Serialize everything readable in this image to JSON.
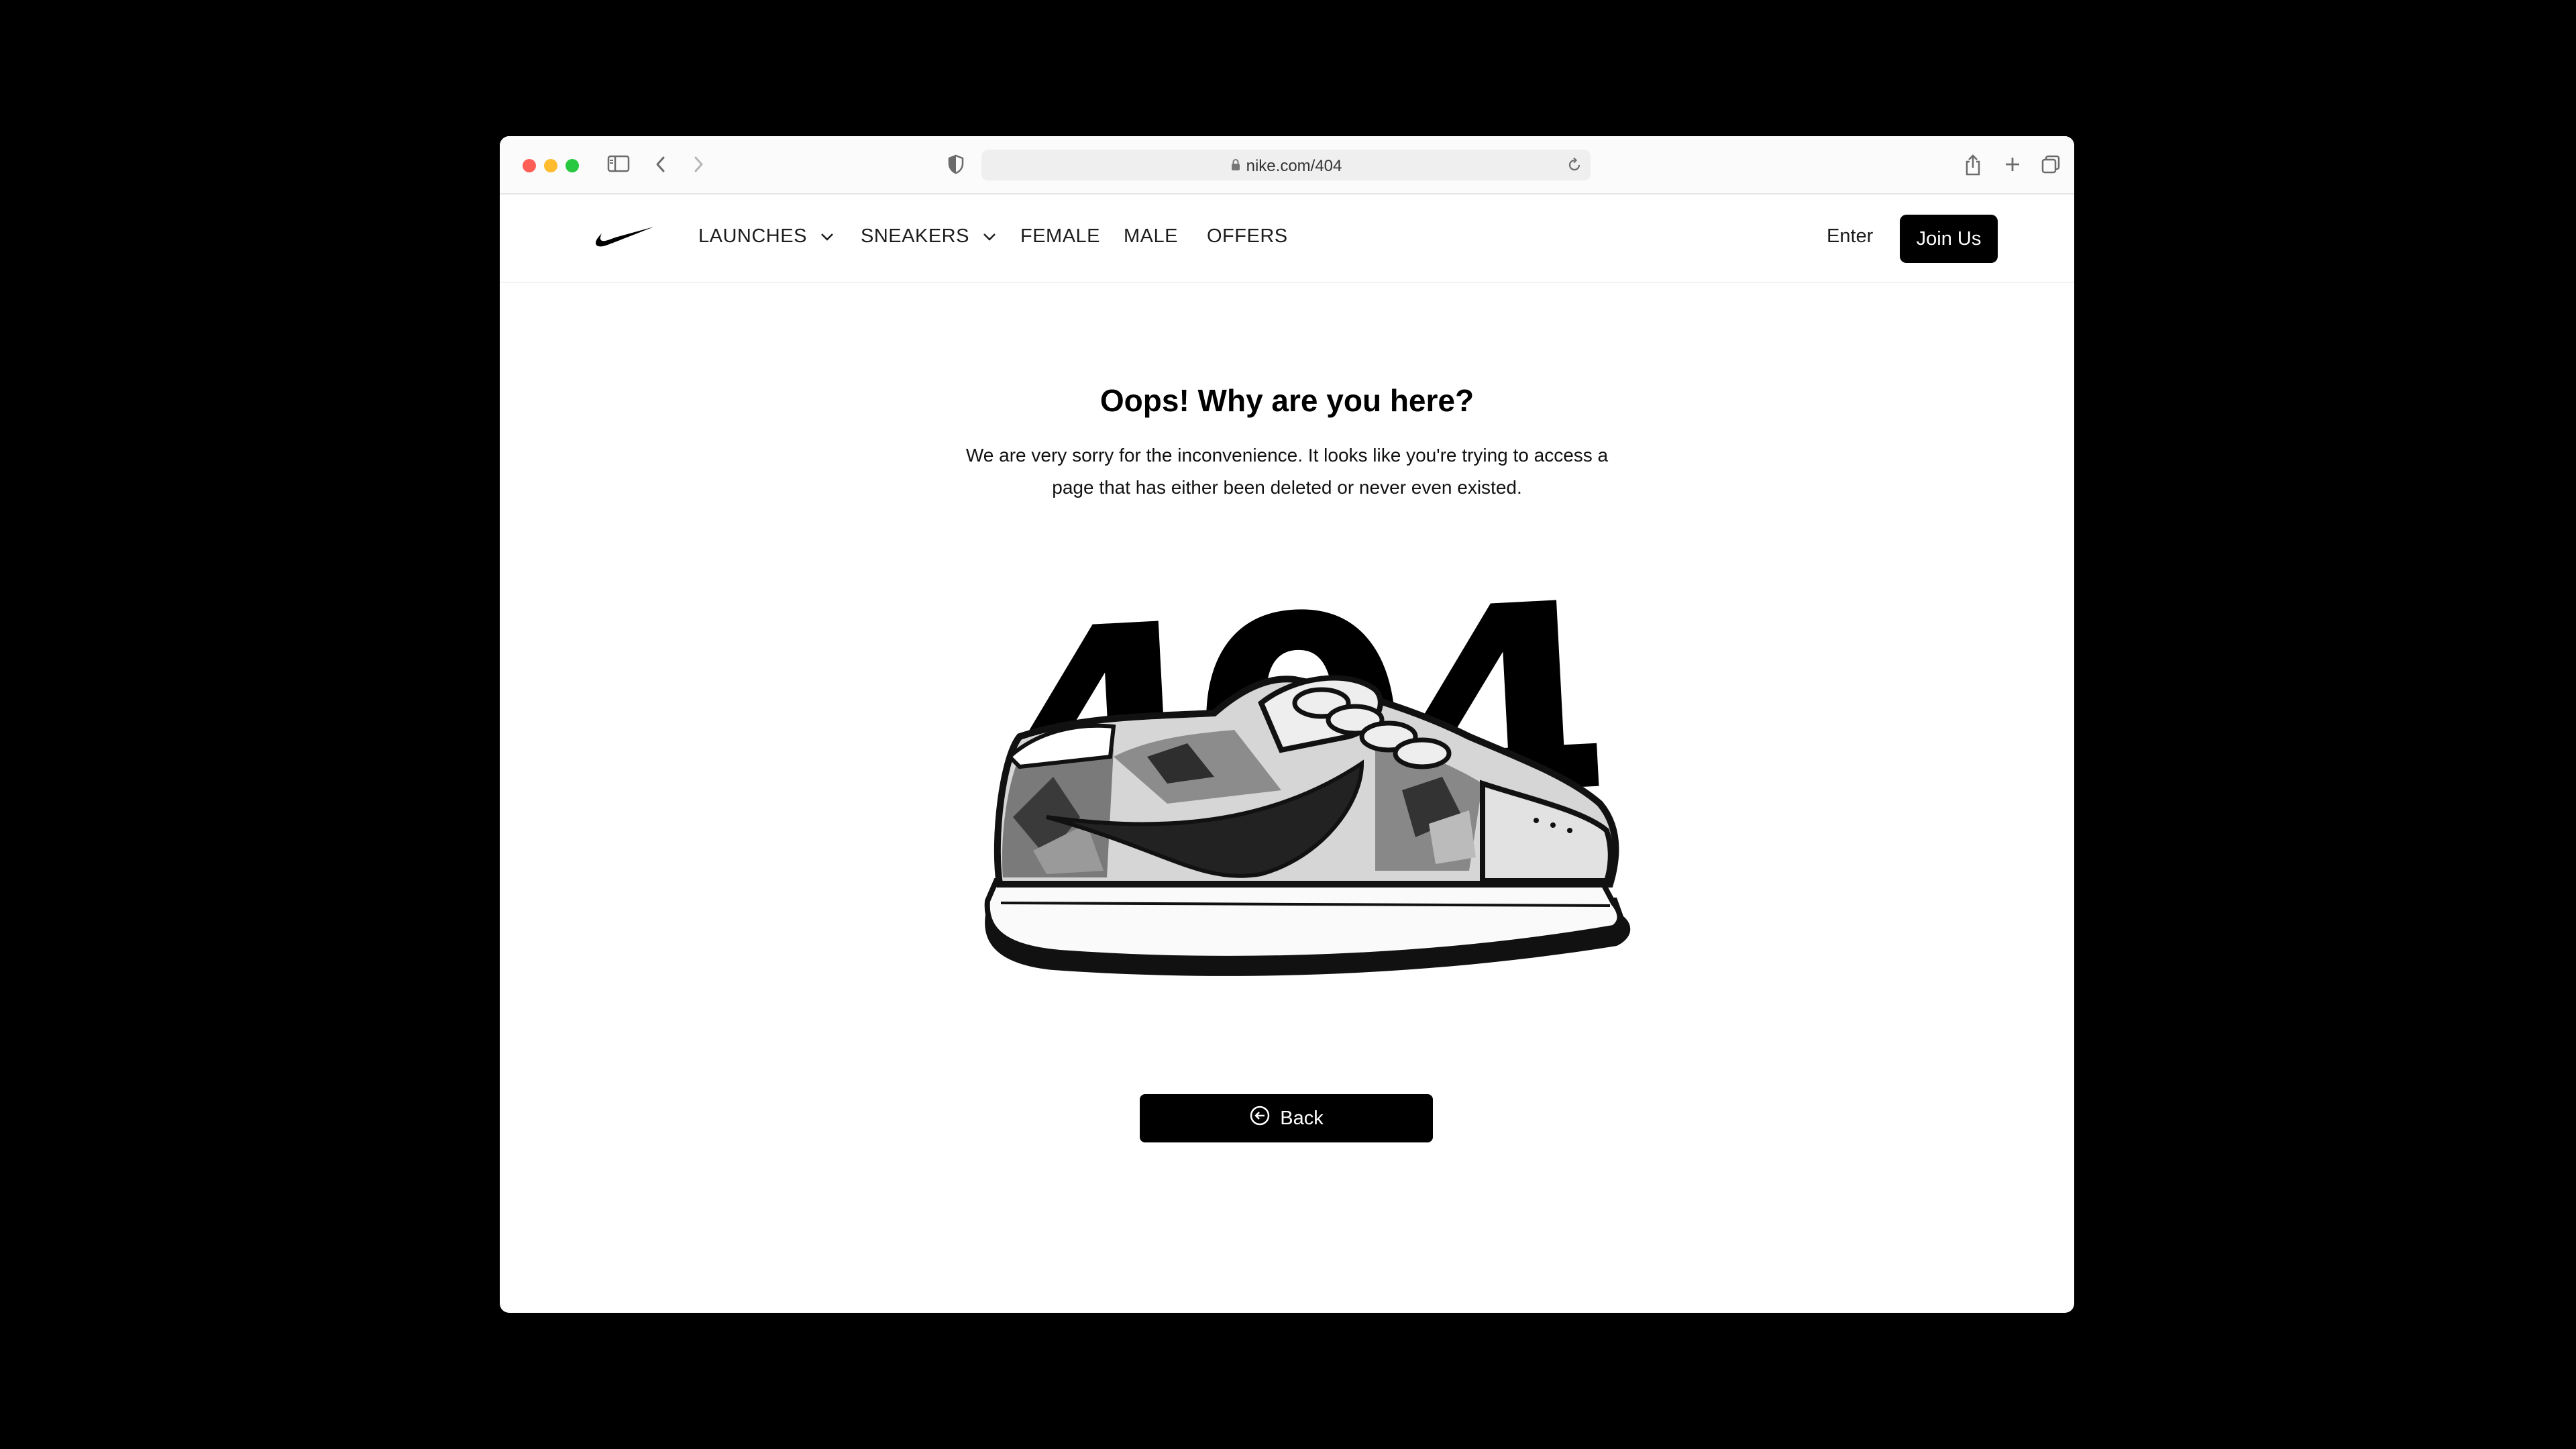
{
  "browser": {
    "url": "nike.com/404"
  },
  "nav": {
    "items": [
      {
        "label": "LAUNCHES",
        "dropdown": true
      },
      {
        "label": "SNEAKERS",
        "dropdown": true
      },
      {
        "label": "FEMALE",
        "dropdown": false
      },
      {
        "label": "MALE",
        "dropdown": false
      },
      {
        "label": "OFFERS",
        "dropdown": false
      }
    ],
    "enter_label": "Enter",
    "join_label": "Join Us"
  },
  "main": {
    "title": "Oops! Why are you here?",
    "description": "We are very sorry for the inconvenience. It looks like you're trying to access a page that has either been deleted or never even existed.",
    "error_code": "404",
    "back_label": "Back"
  },
  "icons": [
    "sidebar-icon",
    "back-arrow-icon",
    "forward-arrow-icon",
    "shield-icon",
    "lock-icon",
    "reload-icon",
    "share-icon",
    "new-tab-icon",
    "tabs-overview-icon",
    "nike-swoosh-logo",
    "chevron-down-icon",
    "sneaker-illustration",
    "arrow-left-circle-icon"
  ],
  "colors": {
    "primary": "#000000",
    "background": "#ffffff",
    "traffic_red": "#ff5f57",
    "traffic_yellow": "#febc2e",
    "traffic_green": "#28c840"
  }
}
